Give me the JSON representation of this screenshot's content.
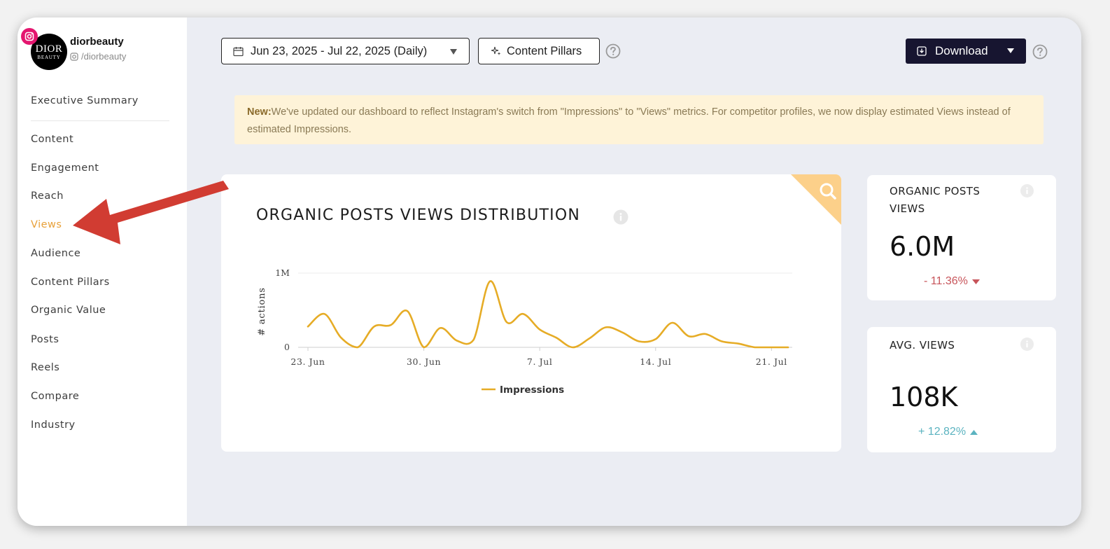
{
  "profile": {
    "logo_line1": "DIOR",
    "logo_line2": "BEAUTY",
    "name": "diorbeauty",
    "handle": "/diorbeauty"
  },
  "nav": [
    "Executive Summary",
    "Content",
    "Engagement",
    "Reach",
    "Views",
    "Audience",
    "Content Pillars",
    "Organic Value",
    "Posts",
    "Reels",
    "Compare",
    "Industry"
  ],
  "active_nav": "Views",
  "toolbar": {
    "date_range": "Jun 23, 2025 - Jul 22, 2025 (Daily)",
    "content_pillars": "Content Pillars",
    "download": "Download"
  },
  "notice": {
    "prefix": "New:",
    "text": "We've updated our dashboard to reflect Instagram's switch from \"Impressions\" to \"Views\" metrics. For competitor profiles, we now display estimated Views instead of estimated Impressions."
  },
  "chart": {
    "title": "ORGANIC POSTS VIEWS DISTRIBUTION",
    "ylabel": "# actions",
    "legend": "Impressions"
  },
  "chart_data": {
    "type": "line",
    "x": [
      "Jun 23",
      "Jun 24",
      "Jun 25",
      "Jun 26",
      "Jun 27",
      "Jun 28",
      "Jun 29",
      "Jun 30",
      "Jul 1",
      "Jul 2",
      "Jul 3",
      "Jul 4",
      "Jul 5",
      "Jul 6",
      "Jul 7",
      "Jul 8",
      "Jul 9",
      "Jul 10",
      "Jul 11",
      "Jul 12",
      "Jul 13",
      "Jul 14",
      "Jul 15",
      "Jul 16",
      "Jul 17",
      "Jul 18",
      "Jul 19",
      "Jul 20",
      "Jul 21",
      "Jul 22"
    ],
    "series": [
      {
        "name": "Impressions",
        "values": [
          280000,
          450000,
          130000,
          0,
          280000,
          300000,
          490000,
          0,
          260000,
          90000,
          100000,
          890000,
          340000,
          450000,
          240000,
          130000,
          0,
          120000,
          270000,
          200000,
          80000,
          110000,
          330000,
          150000,
          180000,
          80000,
          50000,
          0,
          0,
          0
        ]
      }
    ],
    "xticks": [
      "23. Jun",
      "30. Jun",
      "7. Jul",
      "14. Jul",
      "21. Jul"
    ],
    "yticks": [
      "0",
      "1M"
    ],
    "ylim": [
      0,
      1000000
    ],
    "color": "#e6ac26"
  },
  "metrics": [
    {
      "label": "ORGANIC POSTS VIEWS",
      "value": "6.0M",
      "delta": "- 11.36%",
      "direction": "down"
    },
    {
      "label": "AVG. VIEWS",
      "value": "108K",
      "delta": "+ 12.82%",
      "direction": "up"
    }
  ],
  "colors": {
    "accent": "#e8a13a",
    "line": "#e6ac26",
    "download_bg": "#171530",
    "annotation_arrow": "#d13c32"
  }
}
